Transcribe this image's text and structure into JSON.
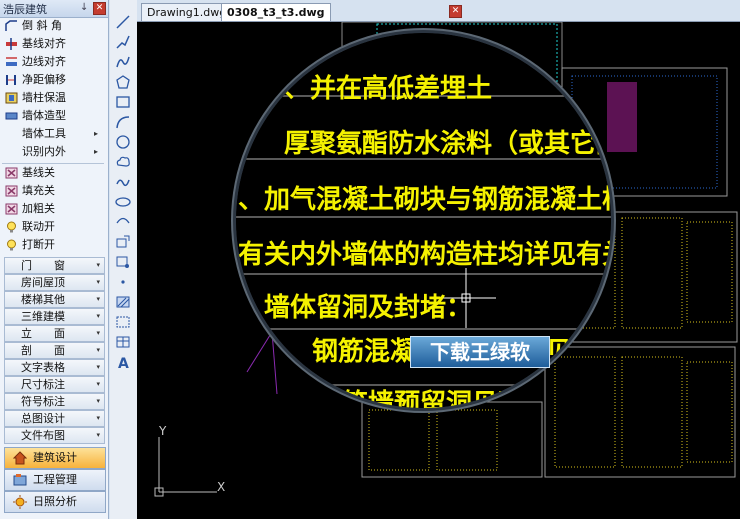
{
  "app": {
    "panel_title": "浩辰建筑",
    "pin_glyph": "↓",
    "close_glyph": "✕"
  },
  "menu": {
    "items": [
      {
        "label": "倒 斜 角",
        "icon": "chamfer-icon"
      },
      {
        "label": "基线对齐",
        "icon": "baseline-align-icon"
      },
      {
        "label": "边线对齐",
        "icon": "edge-align-icon"
      },
      {
        "label": "净距偏移",
        "icon": "offset-icon"
      },
      {
        "label": "墙柱保温",
        "icon": "insulation-icon"
      },
      {
        "label": "墙体造型",
        "icon": "wall-shape-icon"
      },
      {
        "label": "墙体工具",
        "icon": "",
        "arrow": "▸"
      },
      {
        "label": "识别内外",
        "icon": "",
        "arrow": "▸"
      },
      {
        "label": "基线关",
        "icon": "toggle-off-icon"
      },
      {
        "label": "填充关",
        "icon": "toggle-off-icon"
      },
      {
        "label": "加粗关",
        "icon": "toggle-off-icon"
      },
      {
        "label": "联动开",
        "icon": "bulb-icon"
      },
      {
        "label": "打断开",
        "icon": "bulb-icon"
      }
    ],
    "categories": [
      "门　　窗",
      "房间屋顶",
      "楼梯其他",
      "三维建模",
      "立　　面",
      "剖　　面",
      "文字表格",
      "尺寸标注",
      "符号标注",
      "总图设计",
      "文件布图"
    ],
    "dropdown_glyph": "▾",
    "tabs": [
      {
        "label": "建筑设计",
        "active": true
      },
      {
        "label": "工程管理",
        "active": false
      },
      {
        "label": "日照分析",
        "active": false
      }
    ]
  },
  "document_tabs": [
    {
      "label": "Drawing1.dwg",
      "active": false
    },
    {
      "label": "0308_t3_t3.dwg",
      "active": true
    }
  ],
  "doc_close_glyph": "✕",
  "magnifier": {
    "lines": [
      "、并在高低差埋土",
      "厚聚氨酯防水涂料（或其它防",
      "、加气混凝土砌块与钢筋混凝土柱，",
      "有关内外墙体的构造柱均详见有关结施",
      "、墙体留洞及封堵：",
      "钢筋混凝土墙上留洞见结",
      "砌筑墙预留洞见建施和"
    ]
  },
  "watermark": "下载王绿软",
  "ucs": {
    "y_label": "Y",
    "x_label": "X"
  },
  "colors": {
    "drawing_text": "#f5f200",
    "canvas_bg": "#000000",
    "active_tab": "#f7b23b"
  }
}
